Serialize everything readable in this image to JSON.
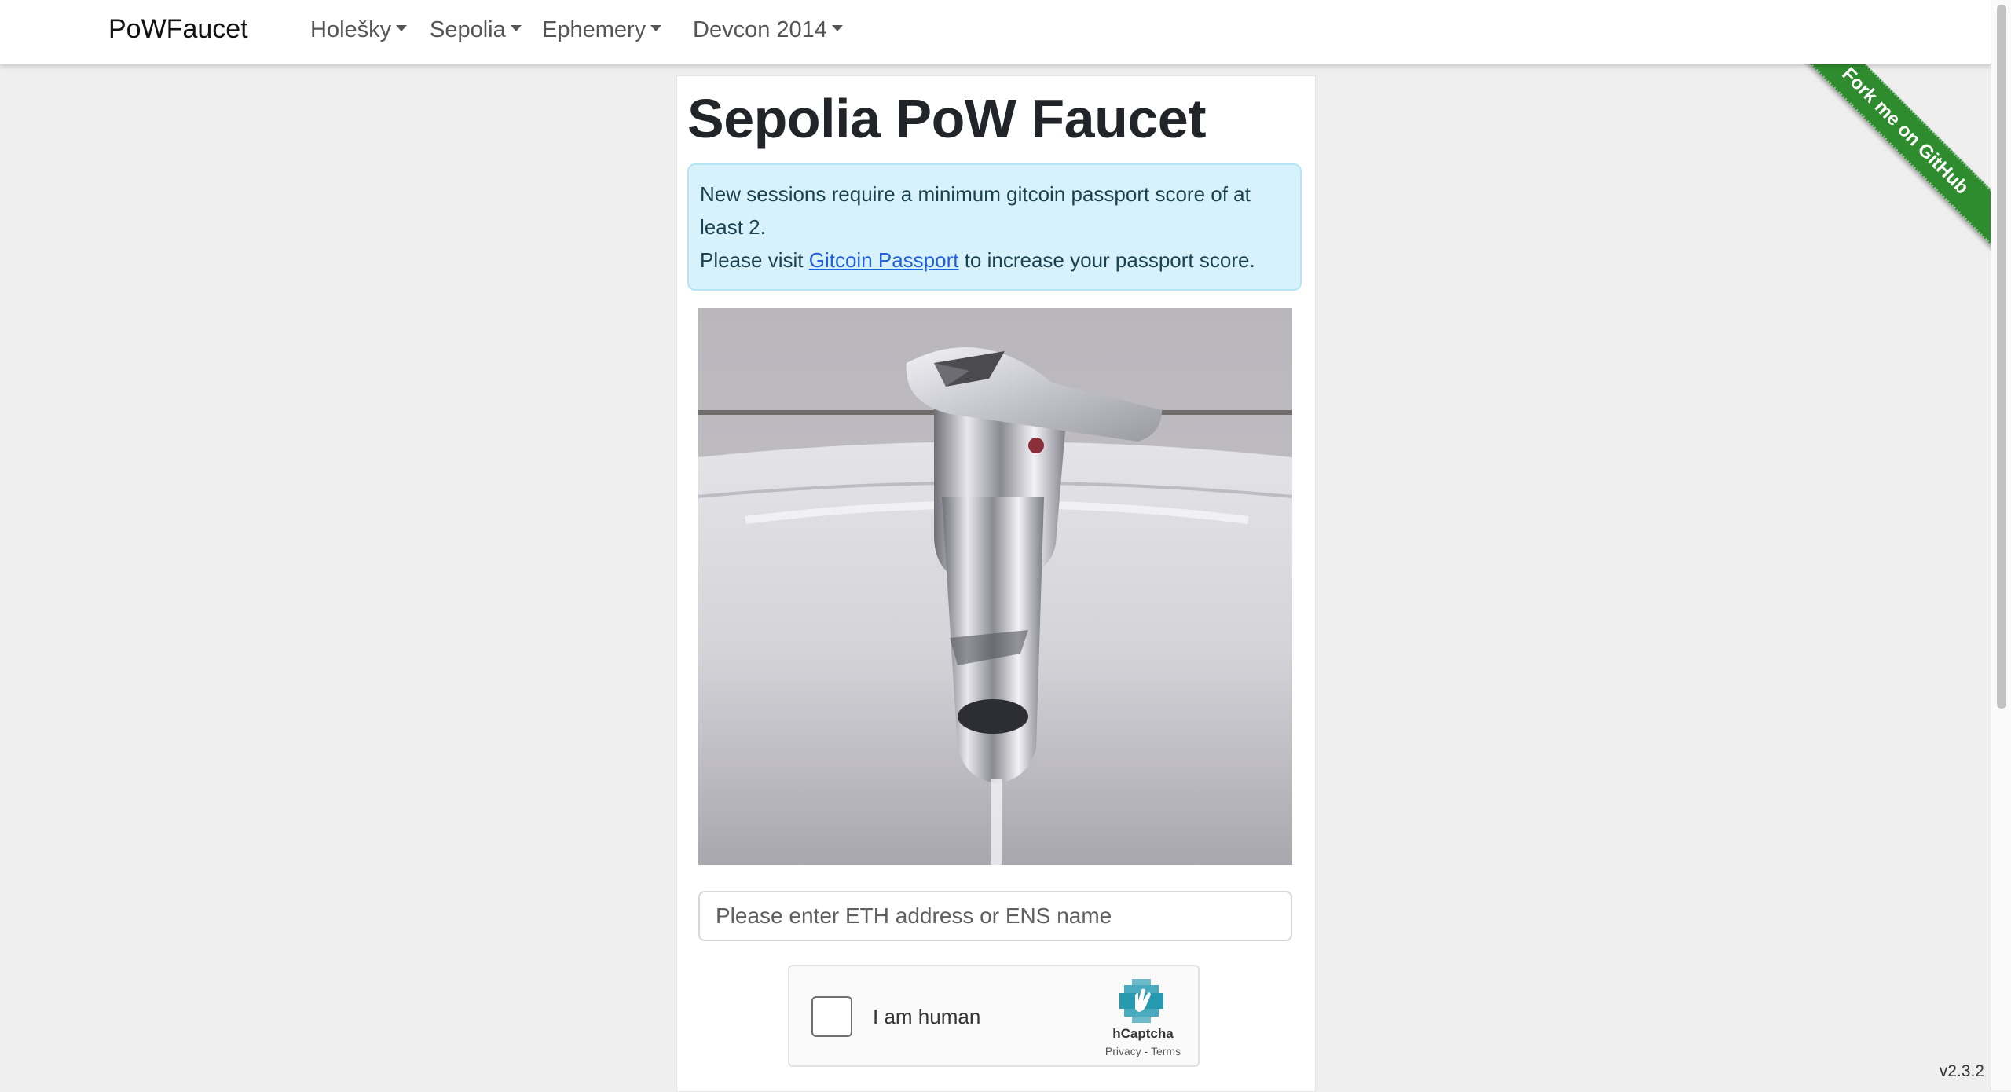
{
  "navbar": {
    "brand": "PoWFaucet",
    "items": [
      {
        "label": "Holešky"
      },
      {
        "label": "Sepolia"
      },
      {
        "label": "Ephemery"
      },
      {
        "label": "Devcon 2014"
      }
    ]
  },
  "ribbon": {
    "label": "Fork me on GitHub",
    "color": "#2e8b2e"
  },
  "main": {
    "title": "Sepolia PoW Faucet",
    "alert": {
      "line1": "New sessions require a minimum gitcoin passport score of at least 2.",
      "line2_prefix": "Please visit ",
      "link_text": "Gitcoin Passport",
      "line2_suffix": " to increase your passport score."
    },
    "image": {
      "icon": "ethereum-logo-icon"
    },
    "address_input": {
      "placeholder": "Please enter ETH address or ENS name",
      "value": ""
    },
    "captcha": {
      "label": "I am human",
      "brand": "hCaptcha",
      "privacy": "Privacy",
      "separator": " - ",
      "terms": "Terms"
    }
  },
  "footer": {
    "version": "v2.3.2"
  },
  "colors": {
    "alert_bg": "#d7f2fb",
    "link": "#2160d9",
    "ribbon": "#2e8b2e"
  }
}
